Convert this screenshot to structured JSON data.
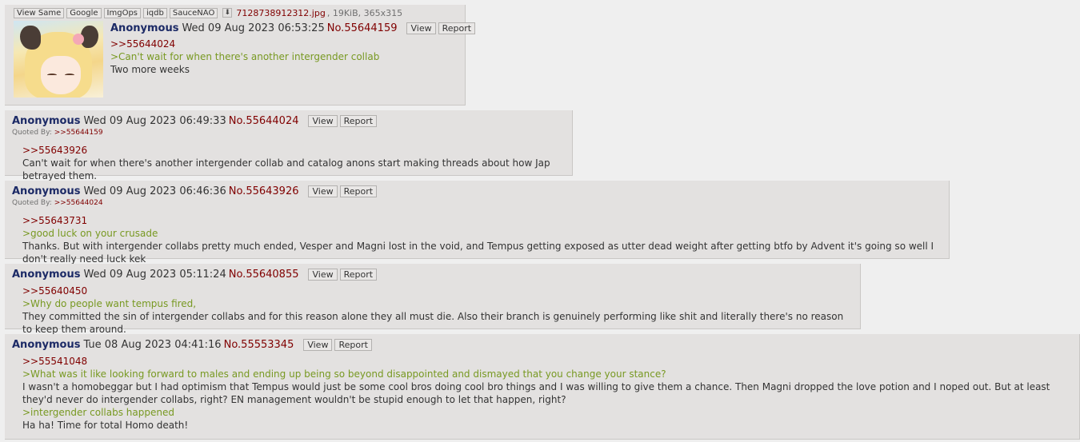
{
  "first_post": {
    "file_tools": [
      "View Same",
      "Google",
      "ImgOps",
      "iqdb",
      "SauceNAO"
    ],
    "download_icon": "download-icon",
    "file_name": "7128738912312.jpg",
    "file_info": ", 19KiB, 365x315",
    "name": "Anonymous",
    "date": "Wed 09 Aug 2023 06:53:25",
    "number": "No.55644159",
    "view_label": "View",
    "report_label": "Report",
    "lines": [
      {
        "type": "ref",
        "text": ">>55644024"
      },
      {
        "type": "greentext",
        "text": ">Can't wait for when there's another intergender collab"
      },
      {
        "type": "text",
        "text": "Two more weeks"
      }
    ]
  },
  "posts": [
    {
      "name": "Anonymous",
      "date": "Wed 09 Aug 2023 06:49:33",
      "number": "No.55644024",
      "view_label": "View",
      "report_label": "Report",
      "quoted_by_label": "Quoted By:",
      "quoted_by": ">>55644159",
      "lines": [
        {
          "type": "ref",
          "text": ">>55643926"
        },
        {
          "type": "text",
          "text": "Can't wait for when there's another intergender collab and catalog anons start making threads about how Jap betrayed them."
        }
      ]
    },
    {
      "name": "Anonymous",
      "date": "Wed 09 Aug 2023 06:46:36",
      "number": "No.55643926",
      "view_label": "View",
      "report_label": "Report",
      "quoted_by_label": "Quoted By:",
      "quoted_by": ">>55644024",
      "lines": [
        {
          "type": "ref",
          "text": ">>55643731"
        },
        {
          "type": "greentext",
          "text": ">good luck on your crusade"
        },
        {
          "type": "text",
          "text": "Thanks. But with intergender collabs pretty much ended, Vesper and Magni lost in the void, and Tempus getting exposed as utter dead weight after getting btfo by Advent it's going so well I don't really need luck kek"
        }
      ]
    },
    {
      "name": "Anonymous",
      "date": "Wed 09 Aug 2023 05:11:24",
      "number": "No.55640855",
      "view_label": "View",
      "report_label": "Report",
      "lines": [
        {
          "type": "ref",
          "text": ">>55640450"
        },
        {
          "type": "greentext",
          "text": ">Why do people want tempus fired,"
        },
        {
          "type": "text",
          "text": "They committed the sin of intergender collabs and for this reason alone they all must die. Also their branch is genuinely performing like shit and literally there's no reason to keep them around."
        }
      ]
    },
    {
      "name": "Anonymous",
      "date": "Tue 08 Aug 2023 04:41:16",
      "number": "No.55553345",
      "view_label": "View",
      "report_label": "Report",
      "lines": [
        {
          "type": "ref",
          "text": ">>55541048"
        },
        {
          "type": "greentext",
          "text": ">What was it like looking forward to males and ending up being so beyond disappointed and dismayed that you change your stance?"
        },
        {
          "type": "text",
          "text": "I wasn't a homobeggar but I had optimism that Tempus would just be some cool bros doing cool bro things and I was willing to give them a chance. Then Magni dropped the love potion and I noped out. But at least they'd never do intergender collabs, right? EN management wouldn't be stupid enough to let that happen, right?"
        },
        {
          "type": "greentext",
          "text": ">intergender collabs happened"
        },
        {
          "type": "text",
          "text": "Ha ha! Time for total Homo death!"
        }
      ]
    }
  ],
  "colors": {
    "page_bg": "#efefef",
    "post_bg": "#e3e1e0",
    "name": "#1c2a66",
    "postno": "#800000",
    "ref": "#800000",
    "greentext": "#789922"
  }
}
